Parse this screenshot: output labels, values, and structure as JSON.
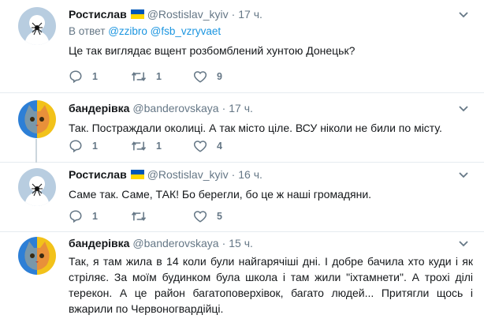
{
  "tweets": [
    {
      "name": "Ростислав",
      "handle": "@Rostislav_kyiv",
      "time": "17 ч.",
      "reply_prefix": "В ответ",
      "mentions": [
        "@zzibro",
        "@fsb_vzryvaet"
      ],
      "text": "Це так виглядає вщент розбомблений хунтою Донецьк?",
      "replies": "1",
      "retweets": "1",
      "likes": "9",
      "avatar": "spider-avatar",
      "flag": "ua-flag-icon"
    },
    {
      "name": "бандерівка",
      "handle": "@banderovskaya",
      "time": "17 ч.",
      "text": "Так. Постраждали околиці. А так місто ціле. ВСУ ніколи не били по місту.",
      "replies": "1",
      "retweets": "1",
      "likes": "4",
      "avatar": "cat-avatar"
    },
    {
      "name": "Ростислав",
      "handle": "@Rostislav_kyiv",
      "time": "16 ч.",
      "text": "Саме так. Саме, ТАК! Бо берегли, бо це ж наші громадяни.",
      "replies": "1",
      "retweets": "",
      "likes": "5",
      "avatar": "spider-avatar",
      "flag": "ua-flag-icon"
    },
    {
      "name": "бандерівка",
      "handle": "@banderovskaya",
      "time": "15 ч.",
      "text": "Так, я там жила в 14 коли були найгарячіші дні. І добре бачила хто куди і як стріляє. За моїм будинком була школа і там жили \"іхтамнети\". А трохі ділі терекон. А це район багатоповерхівок, багато людей... Притягли щось і вжарили по Червоногвардійці.",
      "avatar": "cat-avatar"
    }
  ],
  "colors": {
    "link": "#1b95e0",
    "muted": "#657786",
    "text": "#14171a",
    "flag_blue": "#0057b7",
    "flag_yellow": "#ffd700"
  }
}
